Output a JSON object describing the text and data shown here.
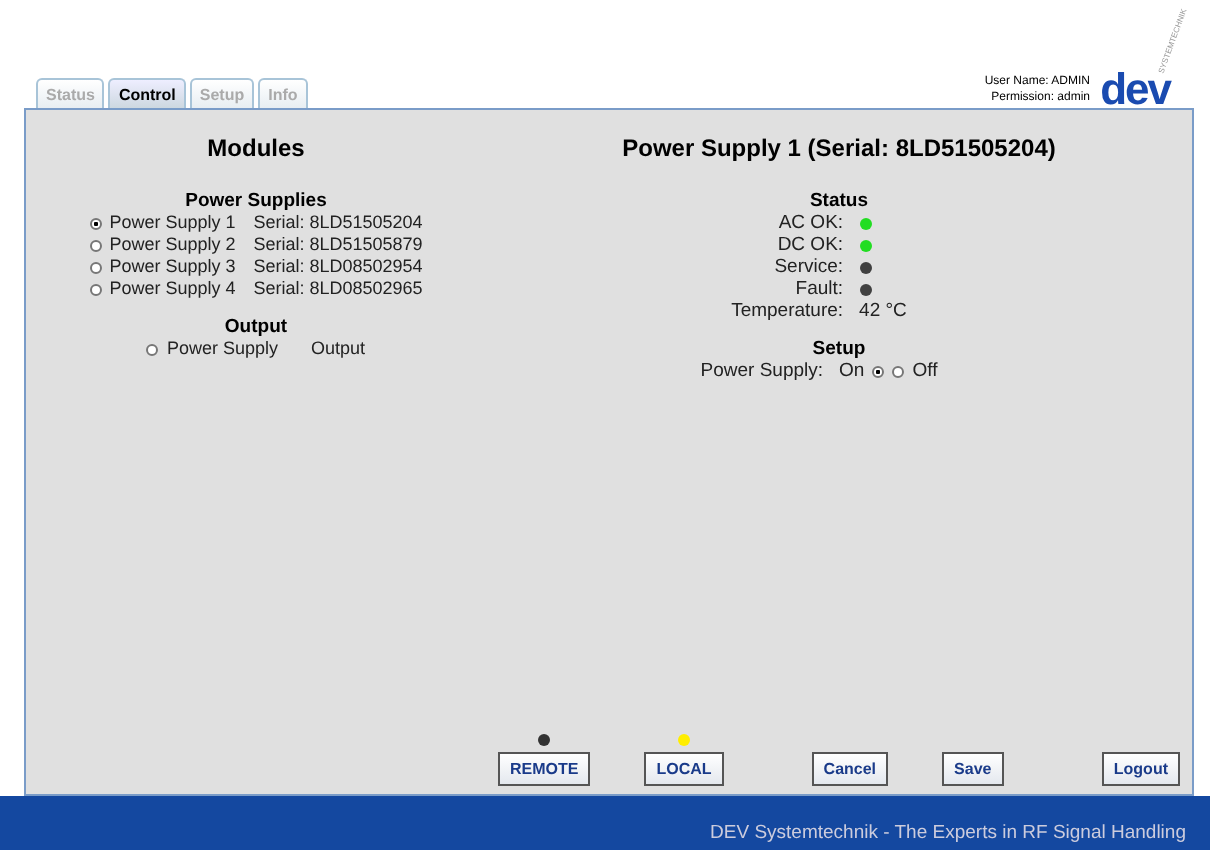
{
  "tabs": [
    {
      "label": "Status",
      "selected": false,
      "disabled": true
    },
    {
      "label": "Control",
      "selected": true,
      "disabled": false
    },
    {
      "label": "Setup",
      "selected": false,
      "disabled": true
    },
    {
      "label": "Info",
      "selected": false,
      "disabled": true
    }
  ],
  "user": {
    "name": "User Name: ADMIN",
    "permission": "Permission: admin"
  },
  "logo": {
    "text": "dev",
    "subtext": "SYSTEMTECHNIK"
  },
  "modules": {
    "title": "Modules",
    "supplies_title": "Power Supplies",
    "supplies": [
      {
        "name": "Power Supply 1",
        "serial": "Serial: 8LD51505204",
        "selected": true
      },
      {
        "name": "Power Supply 2",
        "serial": "Serial: 8LD51505879",
        "selected": false
      },
      {
        "name": "Power Supply 3",
        "serial": "Serial: 8LD08502954",
        "selected": false
      },
      {
        "name": "Power Supply 4",
        "serial": "Serial: 8LD08502965",
        "selected": false
      }
    ],
    "output_title": "Output",
    "outputs": [
      {
        "name": "Power Supply",
        "serial": "Output",
        "selected": false
      }
    ]
  },
  "detail": {
    "title": "Power Supply 1 (Serial: 8LD51505204)",
    "status_title": "Status",
    "status": [
      {
        "label": "AC OK:",
        "kind": "led",
        "color": "#22dd22"
      },
      {
        "label": "DC OK:",
        "kind": "led",
        "color": "#22dd22"
      },
      {
        "label": "Service:",
        "kind": "led",
        "color": "#404040"
      },
      {
        "label": "Fault:",
        "kind": "led",
        "color": "#404040"
      },
      {
        "label": "Temperature:",
        "kind": "text",
        "value": "42 °C"
      }
    ],
    "setup_title": "Setup",
    "setup_label": "Power Supply:",
    "options": [
      {
        "label": "On",
        "selected": true
      },
      {
        "label": "Off",
        "selected": false
      }
    ]
  },
  "indicators": [
    {
      "button": "REMOTE",
      "color": "#333333"
    },
    {
      "button": "LOCAL",
      "color": "#ffee00"
    }
  ],
  "buttons": [
    "Cancel",
    "Save",
    "Logout"
  ],
  "footer": "DEV Systemtechnik - The Experts in RF Signal Handling"
}
